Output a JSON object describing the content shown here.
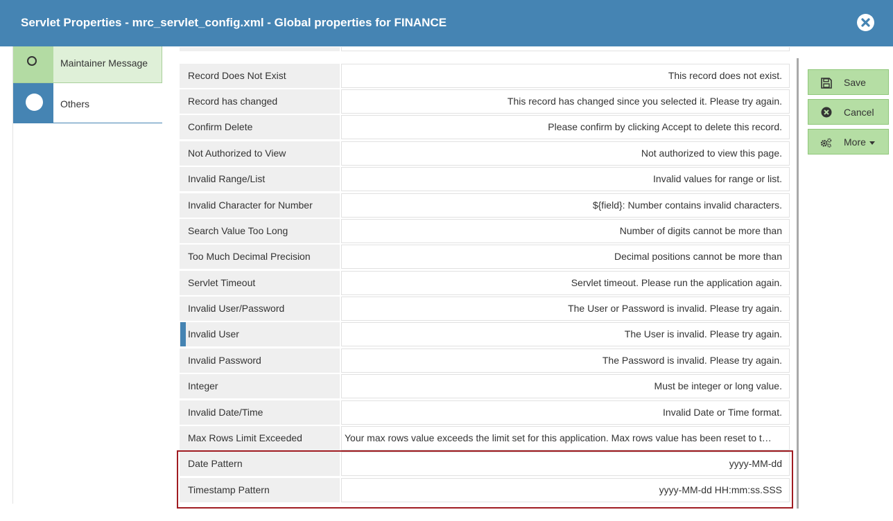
{
  "window": {
    "title": "Servlet Properties - mrc_servlet_config.xml - Global properties for FINANCE"
  },
  "nav": {
    "items": [
      {
        "label": "Maintainer Message",
        "state": "partial"
      },
      {
        "label": "Others",
        "state": "active"
      }
    ]
  },
  "buttons": {
    "save": "Save",
    "cancel": "Cancel",
    "more": "More"
  },
  "properties": [
    {
      "label": "Record Does Not Exist",
      "value": "This record does not exist."
    },
    {
      "label": "Record has changed",
      "value": "This record has changed since you selected it. Please try again."
    },
    {
      "label": "Confirm Delete",
      "value": "Please confirm by clicking Accept to delete this record."
    },
    {
      "label": "Not Authorized to View",
      "value": "Not authorized to view this page."
    },
    {
      "label": "Invalid Range/List",
      "value": "Invalid values for range or list."
    },
    {
      "label": "Invalid Character for Number",
      "value": "${field}: Number contains invalid characters."
    },
    {
      "label": "Search Value Too Long",
      "value": "Number of digits cannot be more than"
    },
    {
      "label": "Too Much Decimal Precision",
      "value": "Decimal positions cannot be more than"
    },
    {
      "label": "Servlet Timeout",
      "value": "Servlet timeout. Please run the application again."
    },
    {
      "label": "Invalid User/Password",
      "value": "The User or Password is invalid. Please try again."
    },
    {
      "label": "Invalid User",
      "value": "The User is invalid. Please try again."
    },
    {
      "label": "Invalid Password",
      "value": "The Password is invalid. Please try again."
    },
    {
      "label": "Integer",
      "value": "Must be integer or long value."
    },
    {
      "label": "Invalid Date/Time",
      "value": "Invalid Date or Time format."
    },
    {
      "label": "Max Rows Limit Exceeded",
      "value": "Your max rows value exceeds the limit set for this application. Max rows value has been reset to t…"
    },
    {
      "label": "Date Pattern",
      "value": "yyyy-MM-dd"
    },
    {
      "label": "Timestamp Pattern",
      "value": "yyyy-MM-dd HH:mm:ss.SSS"
    }
  ],
  "colors": {
    "header": "#4584b3",
    "button": "#b5dea4",
    "highlight": "#a01c22"
  }
}
